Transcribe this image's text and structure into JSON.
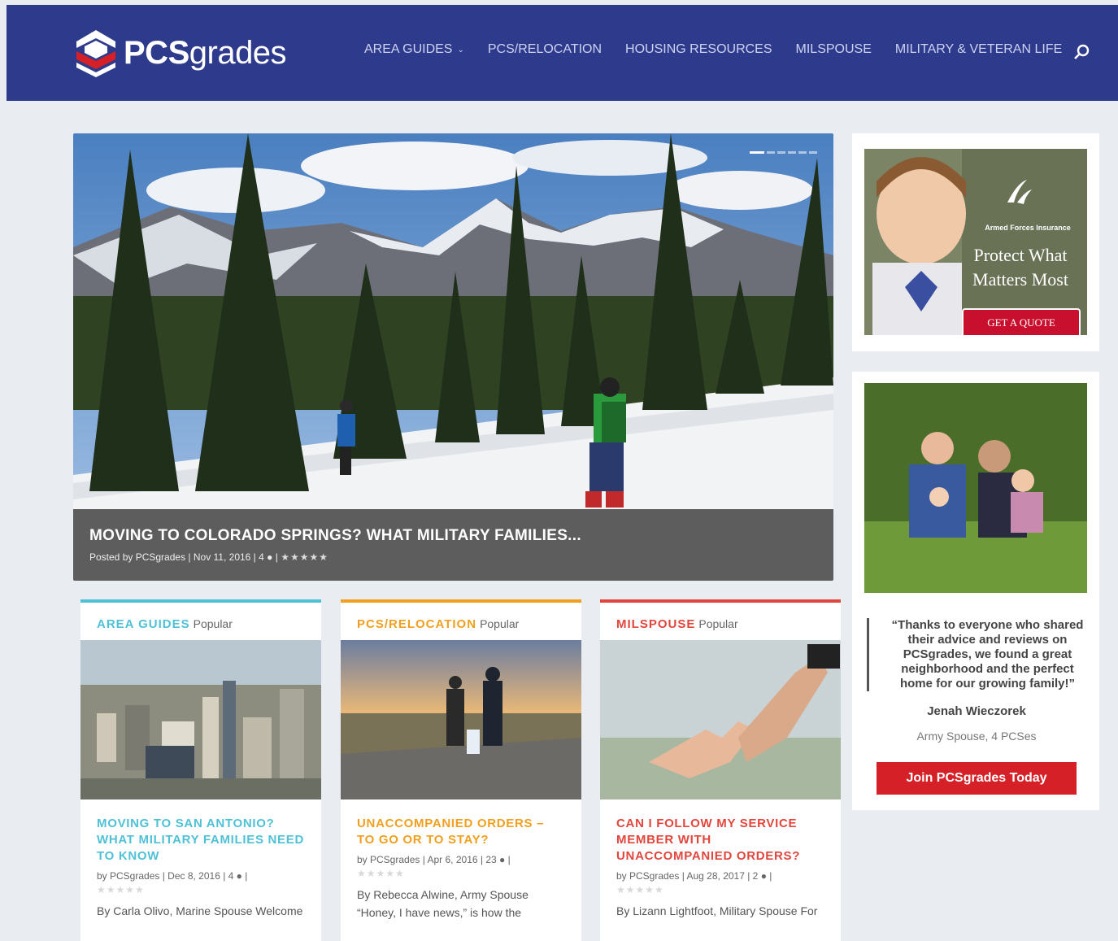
{
  "brand": {
    "logo_bold": "PCS",
    "logo_light": "grades"
  },
  "nav": {
    "items": [
      {
        "label": "AREA GUIDES"
      },
      {
        "label": "PCS/RELOCATION"
      },
      {
        "label": "HOUSING RESOURCES"
      },
      {
        "label": "MILSPOUSE"
      },
      {
        "label": "MILITARY & VETERAN LIFE"
      }
    ]
  },
  "hero": {
    "title": "MOVING TO COLORADO SPRINGS? WHAT MILITARY FAMILIES...",
    "meta_prefix": "Posted by PCSgrades | Nov 11, 2016 | 4",
    "rating": "★★★★★",
    "slide_count": 6,
    "active_slide": 1
  },
  "cards": [
    {
      "category": "AREA GUIDES",
      "tag": "Popular",
      "color": "#4fc1d6",
      "title": "MOVING TO SAN ANTONIO? WHAT MILITARY FAMILIES NEED TO KNOW",
      "meta": "by PCSgrades | Dec 8, 2016 | 4",
      "stars": "★★★★★",
      "excerpt": "By Carla Olivo, Marine Spouse Welcome"
    },
    {
      "category": "PCS/RELOCATION",
      "tag": "Popular",
      "color": "#f0a01e",
      "title": "UNACCOMPANIED ORDERS – TO GO OR TO STAY?",
      "meta": "by PCSgrades | Apr 6, 2016 | 23",
      "stars": "★★★★★",
      "excerpt": "By Rebecca Alwine, Army Spouse “Honey, I have news,” is how the"
    },
    {
      "category": "MILSPOUSE",
      "tag": "Popular",
      "color": "#e2453c",
      "title": "CAN I FOLLOW MY SERVICE MEMBER WITH UNACCOMPANIED ORDERS?",
      "meta": "by PCSgrades | Aug 28, 2017 | 2",
      "stars": "★★★★★",
      "excerpt": "By Lizann Lightfoot, Military Spouse For"
    }
  ],
  "ad": {
    "brand": "Armed Forces Insurance",
    "headline": "Protect What Matters Most",
    "cta": "GET A QUOTE"
  },
  "testimonial": {
    "quote": "“Thanks to everyone who shared their advice and reviews on PCSgrades, we found a great neighborhood and the perfect home for our growing family!”",
    "name": "Jenah Wieczorek",
    "role": "Army Spouse, 4 PCSes",
    "button": "Join PCSgrades Today"
  },
  "colors": {
    "header": "#2e3a8c",
    "join_button": "#d62027",
    "page_bg": "#e9edf1"
  }
}
